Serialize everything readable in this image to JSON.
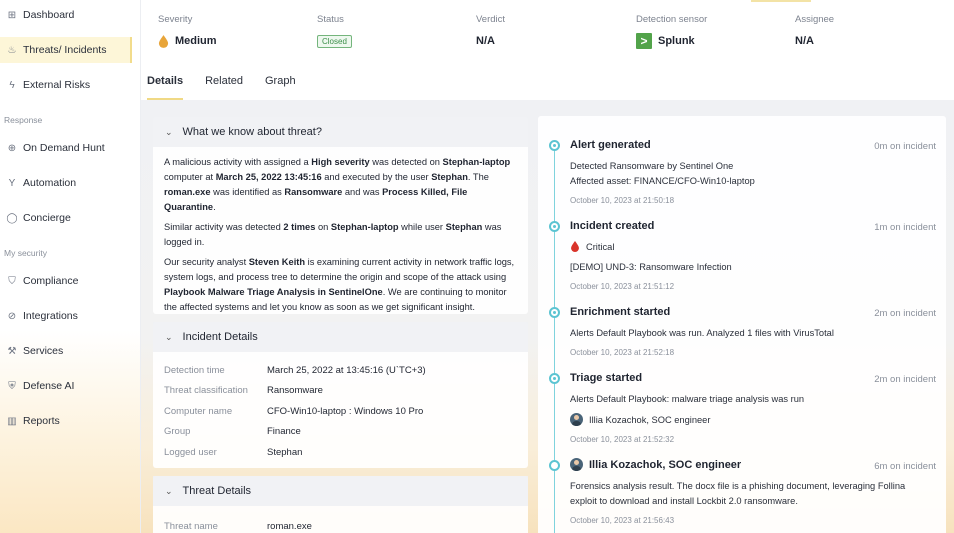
{
  "sidebar": {
    "items": [
      {
        "label": "Dashboard",
        "icon": "grid-icon"
      },
      {
        "label": "Threats/ Incidents",
        "icon": "flame-icon",
        "active": true
      },
      {
        "label": "External Risks",
        "icon": "lightning-icon"
      }
    ],
    "section_response": "Response",
    "response_items": [
      {
        "label": "On Demand Hunt",
        "icon": "crosshair-icon"
      },
      {
        "label": "Automation",
        "icon": "branch-icon"
      },
      {
        "label": "Concierge",
        "icon": "chat-icon"
      }
    ],
    "section_security": "My security",
    "security_items": [
      {
        "label": "Compliance",
        "icon": "shield-check-icon"
      },
      {
        "label": "Integrations",
        "icon": "plug-icon"
      },
      {
        "label": "Services",
        "icon": "wrench-icon"
      },
      {
        "label": "Defense AI",
        "icon": "shield-icon"
      },
      {
        "label": "Reports",
        "icon": "bar-chart-icon"
      }
    ]
  },
  "summary": {
    "severity_label": "Severity",
    "severity_value": "Medium",
    "status_label": "Status",
    "status_value": "Closed",
    "verdict_label": "Verdict",
    "verdict_value": "N/A",
    "sensor_label": "Detection sensor",
    "sensor_value": "Splunk",
    "assignee_label": "Assignee",
    "assignee_value": "N/A"
  },
  "tabs": [
    "Details",
    "Related",
    "Graph"
  ],
  "threat_panel": {
    "title": "What we know about threat?",
    "p1": [
      {
        "t": "A malicious activity with assigned a "
      },
      {
        "t": "High severity",
        "b": true
      },
      {
        "t": " was detected on "
      },
      {
        "t": "Stephan-laptop",
        "b": true
      },
      {
        "t": " computer at "
      },
      {
        "t": "March 25, 2022 13:45:16",
        "b": true
      },
      {
        "t": " and executed by the user "
      },
      {
        "t": "Stephan",
        "b": true
      },
      {
        "t": ". The "
      },
      {
        "t": "roman.exe",
        "b": true
      },
      {
        "t": " was identified as "
      },
      {
        "t": "Ransomware",
        "b": true
      },
      {
        "t": " and was "
      },
      {
        "t": "Process Killed, File Quarantine",
        "b": true
      },
      {
        "t": "."
      }
    ],
    "p2": [
      {
        "t": "Similar activity was detected "
      },
      {
        "t": "2 times",
        "b": true
      },
      {
        "t": " on "
      },
      {
        "t": "Stephan-laptop",
        "b": true
      },
      {
        "t": " while user "
      },
      {
        "t": "Stephan",
        "b": true
      },
      {
        "t": " was logged in."
      }
    ],
    "p3": [
      {
        "t": "Our security analyst "
      },
      {
        "t": "Steven Keith",
        "b": true
      },
      {
        "t": " is examining current activity in network traffic logs, system logs, and process tree to determine the origin and scope of the attack using "
      },
      {
        "t": "Playbook Malware Triage Analysis in SentinelOne",
        "b": true
      },
      {
        "t": ". We are continuing to monitor the affected systems and let you know as soon as we get significant insight."
      }
    ]
  },
  "incident_panel": {
    "title": "Incident Details",
    "rows": [
      {
        "key": "Detection time",
        "value": "March 25, 2022 at 13:45:16 (U`TC+3)"
      },
      {
        "key": "Threat  classification",
        "value": "Ransomware"
      },
      {
        "key": "Computer name",
        "value": "CFO-Win10-laptop : Windows 10 Pro"
      },
      {
        "key": "Group",
        "value": "Finance"
      },
      {
        "key": "Logged user",
        "value": "Stephan"
      }
    ]
  },
  "threat_details_panel": {
    "title": "Threat Details",
    "rows": [
      {
        "key": "Threat name",
        "value": "roman.exe"
      }
    ]
  },
  "timeline": [
    {
      "title": "Alert generated",
      "meta": "0m on incident",
      "lines": [
        "Detected Ransomware by Sentinel One",
        "Affected asset: FINANCE/CFO-Win10-laptop"
      ],
      "time": "October 10, 2023 at 21:50:18"
    },
    {
      "title": "Incident created",
      "meta": "1m on incident",
      "severity": "Critical",
      "lines": [
        "[DEMO] UND-3: Ransomware Infection"
      ],
      "time": "October 10, 2023 at 21:51:12"
    },
    {
      "title": "Enrichment started",
      "meta": "2m on incident",
      "lines": [
        "Alerts Default Playbook was run. Analyzed 1 files with VirusTotal"
      ],
      "time": "October 10, 2023 at 21:52:18"
    },
    {
      "title": "Triage started",
      "meta": "2m on incident",
      "lines": [
        "Alerts Default Playbook: malware triage analysis was run"
      ],
      "person": "Illia Kozachok, SOC engineer",
      "time": "October 10, 2023 at 21:52:32"
    },
    {
      "title": "Illia Kozachok, SOC engineer",
      "meta": "6m on incident",
      "lines": [
        "Forensics analysis result. The docx file is a phishing document, leveraging Follina",
        "exploit to download and install Lockbit 2.0 ransomware."
      ],
      "time": "October 10, 2023 at 21:56:43"
    }
  ],
  "colors": {
    "accent_yellow": "#f0d985",
    "timeline_teal": "#5cc4d2",
    "severity_medium": "#e8a53a",
    "severity_critical": "#d9342b",
    "splunk_green": "#52a34a",
    "closed_green": "#3c8f4a"
  }
}
